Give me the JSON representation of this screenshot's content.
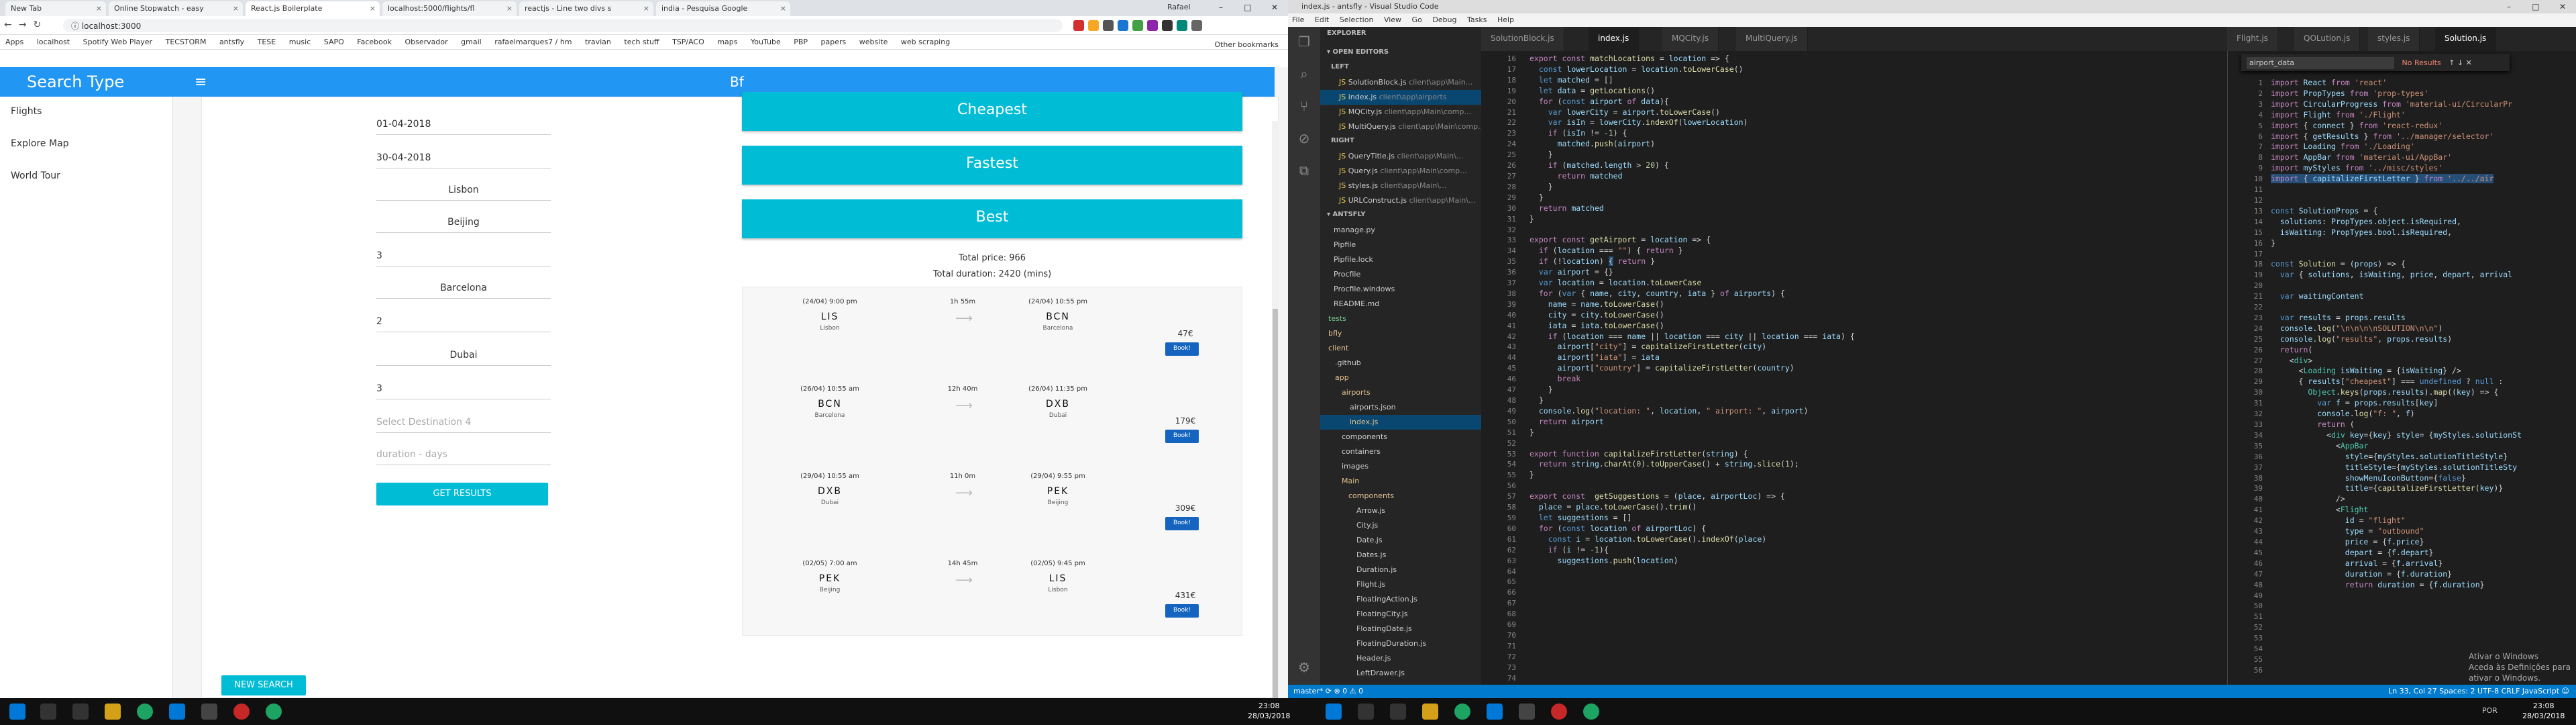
{
  "chrome": {
    "tabs": [
      "New Tab",
      "Online Stopwatch - easy",
      "React.js Boilerplate",
      "localhost:5000/flights/fl",
      "reactjs - Line two divs s",
      "india - Pesquisa Google"
    ],
    "user": "Rafael",
    "url": "localhost:3000",
    "apps_label": "Apps",
    "bookmarks": [
      "localhost",
      "Spotify Web Player",
      "TECSTORM",
      "antsfly",
      "TESE",
      "music",
      "SAPO",
      "Facebook",
      "Observador",
      "gmail",
      "rafaelmarques7 / hm",
      "travian",
      "tech stuff",
      "TSP/ACO",
      "maps",
      "YouTube",
      "PBP",
      "papers",
      "website",
      "web scraping"
    ],
    "other_bookmarks": "Other bookmarks"
  },
  "app": {
    "drawer_title": "Search Type",
    "appbar_title": "Bf",
    "drawer_items": [
      "Flights",
      "Explore Map",
      "World Tour"
    ],
    "form": {
      "date_from": "01-04-2018",
      "date_to": "30-04-2018",
      "origin": "Lisbon",
      "dest1": "Beijing",
      "dest1_days": "3",
      "dest2": "Barcelona",
      "dest2_days": "2",
      "dest3": "Dubai",
      "dest3_days": "3",
      "dest4_placeholder": "Select Destination 4",
      "duration_placeholder": "duration - days",
      "get_results": "GET RESULTS",
      "new_search": "NEW SEARCH"
    },
    "sort_buttons": [
      "Cheapest",
      "Fastest",
      "Best"
    ],
    "total_price": "Total price: 966",
    "total_duration": "Total duration: 2420 (mins)",
    "flights": [
      {
        "dep_time": "(24/04) 9:00 pm",
        "dep_code": "LIS",
        "dep_city": "Lisbon",
        "duration": "1h 55m",
        "arr_time": "(24/04) 10:55 pm",
        "arr_code": "BCN",
        "arr_city": "Barcelona",
        "price": "47€",
        "book": "Book!"
      },
      {
        "dep_time": "(26/04) 10:55 am",
        "dep_code": "BCN",
        "dep_city": "Barcelona",
        "duration": "12h 40m",
        "arr_time": "(26/04) 11:35 pm",
        "arr_code": "DXB",
        "arr_city": "Dubai",
        "price": "179€",
        "book": "Book!"
      },
      {
        "dep_time": "(29/04) 10:55 am",
        "dep_code": "DXB",
        "dep_city": "Dubai",
        "duration": "11h 0m",
        "arr_time": "(29/04) 9:55 pm",
        "arr_code": "PEK",
        "arr_city": "Beijing",
        "price": "309€",
        "book": "Book!"
      },
      {
        "dep_time": "(02/05) 7:00 am",
        "dep_code": "PEK",
        "dep_city": "Beijing",
        "duration": "14h 45m",
        "arr_time": "(02/05) 9:45 pm",
        "arr_code": "LIS",
        "arr_city": "Lisbon",
        "price": "431€",
        "book": "Book!"
      }
    ]
  },
  "vscode": {
    "title": "index.js - antsfly - Visual Studio Code",
    "menu": [
      "File",
      "Edit",
      "Selection",
      "View",
      "Go",
      "Debug",
      "Tasks",
      "Help"
    ],
    "explorer_title": "EXPLORER",
    "open_editors": "OPEN EDITORS",
    "left_group": "LEFT",
    "right_group": "RIGHT",
    "project": "ANTSFLY",
    "open_left": [
      "SolutionBlock.js",
      "index.js",
      "MQCity.js",
      "MultiQuery.js"
    ],
    "open_left_paths": [
      "client\\app\\Main...",
      "client\\app\\airports",
      "client\\app\\Main\\comp...",
      "client\\app\\Main\\comp..."
    ],
    "open_right": [
      "QueryTitle.js",
      "Query.js",
      "styles.js",
      "URLConstruct.js"
    ],
    "open_right_paths": [
      "client\\app\\Main\\...",
      "client\\app\\Main\\comp...",
      "client\\app\\Main\\...",
      "client\\app\\Main\\..."
    ],
    "tree": [
      "manage.py",
      "Pipfile",
      "Pipfile.lock",
      "Procfile",
      "Procfile.windows",
      "README.md",
      "tests",
      "bfly",
      "client",
      ".github",
      "app",
      "airports",
      "airports.json",
      "index.js",
      "components",
      "containers",
      "images",
      "Main",
      "components",
      "Arrow.js",
      "City.js",
      "Date.js",
      "Dates.js",
      "Duration.js",
      "Flight.js",
      "FloatingAction.js",
      "FloatingCity.js",
      "FloatingDate.js",
      "FloatingDuration.js",
      "Header.js",
      "LeftDrawer.js"
    ],
    "tabs_left": [
      "SolutionBlock.js",
      "index.js",
      "MQCity.js",
      "MultiQuery.js"
    ],
    "tabs_right": [
      "Flight.js",
      "QOLution.js",
      "styles.js",
      "Solution.js"
    ],
    "find_text": "airport_data",
    "find_result": "No Results",
    "statusbar_left": "master* ⟳ ⊗ 0 ⚠ 0",
    "statusbar_right": "Ln 33, Col 27   Spaces: 2   UTF-8   CRLF   JavaScript   ☺",
    "watermark_1": "Ativar o Windows",
    "watermark_2": "Aceda às Definições para ativar o Windows."
  },
  "taskbar": {
    "time": "23:08",
    "date": "28/03/2018",
    "lang": "POR"
  }
}
